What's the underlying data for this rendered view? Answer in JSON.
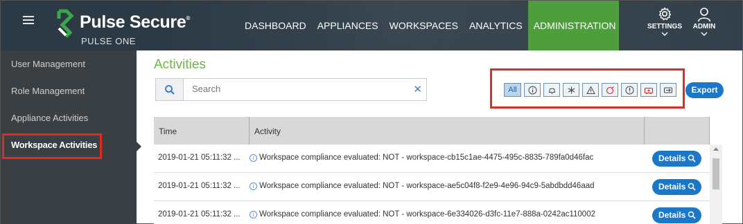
{
  "header": {
    "brand": "Pulse Secure",
    "brand_mark": "®",
    "subtitle": "PULSE ONE",
    "nav": [
      "DASHBOARD",
      "APPLIANCES",
      "WORKSPACES",
      "ANALYTICS",
      "ADMINISTRATION"
    ],
    "active_nav": "ADMINISTRATION",
    "settings_label": "SETTINGS",
    "admin_label": "ADMIN",
    "colors": {
      "bar": "#2c3a45",
      "active": "#4f9e3e"
    }
  },
  "sidebar": {
    "items": [
      "User Management",
      "Role Management",
      "Appliance Activities",
      "Workspace Activities"
    ],
    "active": "Workspace Activities"
  },
  "main": {
    "title": "Activities",
    "search_placeholder": "Search",
    "filters": {
      "all": "All",
      "icons": [
        "info-icon",
        "bell-icon",
        "asterisk-icon",
        "warning-icon",
        "alarm-icon",
        "critical-icon",
        "ambulance-icon",
        "migrate-icon"
      ]
    },
    "export_label": "Export",
    "columns": [
      "Time",
      "Activity",
      ""
    ],
    "rows": [
      {
        "time": "2019-01-21 05:11:32 ...",
        "activity": "Workspace compliance evaluated: NOT - workspace-cb15c1ae-4475-495c-8835-789fa0d46fac",
        "action": "Details"
      },
      {
        "time": "2019-01-21 05:11:32 ...",
        "activity": "Workspace compliance evaluated: NOT - workspace-ae5c04f8-f2e9-4e96-94c9-5abdbdd46aad",
        "action": "Details"
      },
      {
        "time": "2019-01-21 05:11:32 ...",
        "activity": "Workspace compliance evaluated: NOT - workspace-6e334026-d3fc-11e7-888a-0242ac110002",
        "action": "Details"
      }
    ]
  }
}
